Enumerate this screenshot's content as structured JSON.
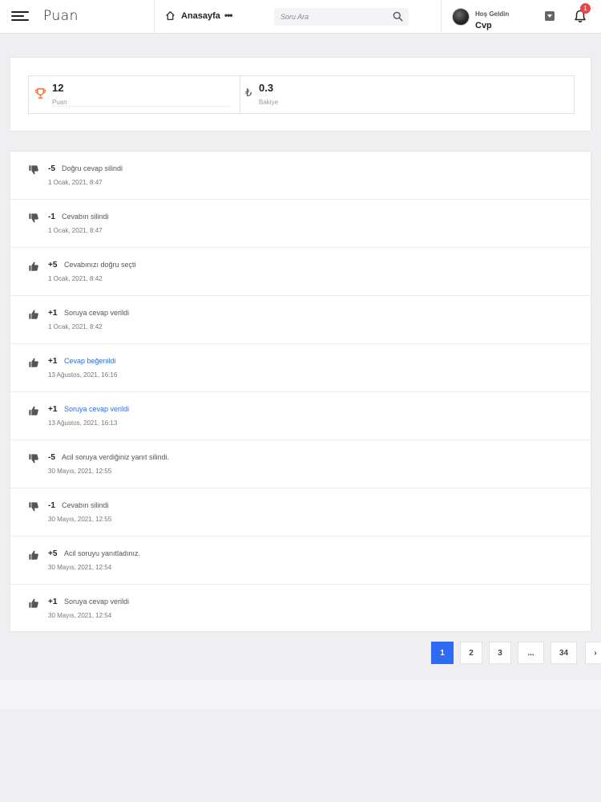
{
  "header": {
    "logo": "Puan",
    "home_label": "Anasayfa",
    "more_label": "•••",
    "search_placeholder": "Soru Ara",
    "welcome": "Hoş Geldin",
    "username": "Cvp",
    "notification_count": "1"
  },
  "stats": [
    {
      "value": "12",
      "label": "Puan",
      "icon": "trophy-icon"
    },
    {
      "value": "0.3",
      "label": "Bakiye",
      "icon": "lira-icon",
      "symbol": "₺"
    }
  ],
  "activities": [
    {
      "points": "-5",
      "type": "down",
      "text": "Doğru cevap silindi",
      "date": "1 Ocak, 2021, 8:47",
      "link": false
    },
    {
      "points": "-1",
      "type": "down",
      "text": "Cevabın silindi",
      "date": "1 Ocak, 2021, 8:47",
      "link": false
    },
    {
      "points": "+5",
      "type": "up",
      "text": "Cevabınızı doğru seçti",
      "date": "1 Ocak, 2021, 8:42",
      "link": false
    },
    {
      "points": "+1",
      "type": "up",
      "text": "Soruya cevap verildi",
      "date": "1 Ocak, 2021, 8:42",
      "link": false
    },
    {
      "points": "+1",
      "type": "up",
      "text": "Cevap beğenildi",
      "date": "13 Ağustos, 2021, 16:16",
      "link": true
    },
    {
      "points": "+1",
      "type": "up",
      "text": "Soruya cevap verildi",
      "date": "13 Ağustos, 2021, 16:13",
      "link": true
    },
    {
      "points": "-5",
      "type": "down",
      "text": "Acil soruya verdiğiniz yanıt silindi.",
      "date": "30 Mayıs, 2021, 12:55",
      "link": false
    },
    {
      "points": "-1",
      "type": "down",
      "text": "Cevabın silindi",
      "date": "30 Mayıs, 2021, 12:55",
      "link": false
    },
    {
      "points": "+5",
      "type": "up",
      "text": "Acil soruyu yanıtladınız.",
      "date": "30 Mayıs, 2021, 12:54",
      "link": false
    },
    {
      "points": "+1",
      "type": "up",
      "text": "Soruya cevap verildi",
      "date": "30 Mayıs, 2021, 12:54",
      "link": false
    }
  ],
  "pagination": {
    "pages": [
      "1",
      "2",
      "3",
      "...",
      "34"
    ],
    "active": "1",
    "next": "›"
  },
  "colors": {
    "accent": "#2c6bf2",
    "link": "#2f6fd9",
    "trophy": "#e8743b",
    "badge": "#e84545"
  }
}
